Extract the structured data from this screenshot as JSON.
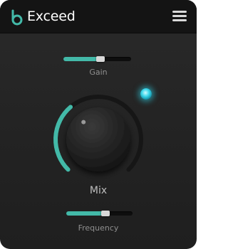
{
  "app": {
    "brand": "Exceed",
    "menu_icon": "hamburger-menu-icon",
    "logo_icon": "exceed-logo-icon"
  },
  "controls": {
    "gain": {
      "label": "Gain",
      "value": 0.55
    },
    "mix": {
      "label": "Mix",
      "value": 0.35
    },
    "frequency": {
      "label": "Frequency",
      "value": 0.59
    }
  },
  "indicator": {
    "state": "on",
    "color": "#39d6ea"
  },
  "colors": {
    "accent": "#43b9a8",
    "header_bg": "#141414",
    "panel_bg": "#242424",
    "text_muted": "#8f8f8f"
  }
}
